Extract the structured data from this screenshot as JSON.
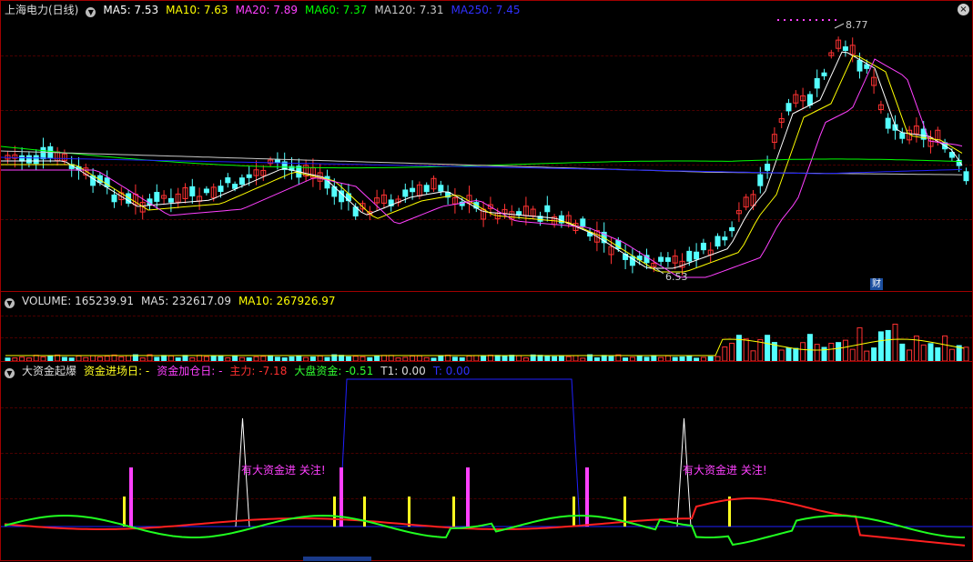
{
  "price_header": {
    "title": "上海电力(日线)",
    "ma5": "MA5: 7.53",
    "ma10": "MA10: 7.63",
    "ma20": "MA20: 7.89",
    "ma60": "MA60: 7.37",
    "ma120": "MA120: 7.31",
    "ma250": "MA250: 7.45"
  },
  "price_marks": {
    "high": "8.77",
    "low": "6.53",
    "finance_badge": "财"
  },
  "volume_header": {
    "label": "VOLUME: 165239.91",
    "ma5": "MA5: 232617.09",
    "ma10": "MA10: 267926.97"
  },
  "indicator_header": {
    "name": "大资金起爆",
    "entry_day": "资金进场日: -",
    "add_day": "资金加仓日: -",
    "main_force": "主力: -7.18",
    "market_fund": "大盘资金: -0.51",
    "t1": "T1: 0.00",
    "t": "T: 0.00"
  },
  "alerts": {
    "left": "有大资金进 关注!",
    "right": "有大资金进 关注!"
  },
  "colors": {
    "up": "#ff3232",
    "down": "#54ffff",
    "ma5": "#ffffff",
    "ma10": "#ffff00",
    "ma20": "#ff40ff",
    "ma60": "#00ff00",
    "ma120": "#c8c8c8",
    "ma250": "#2020ff",
    "main_force": "#ff2020",
    "market_fund": "#20ff20",
    "entry_bar": "#ffff20",
    "add_bar": "#ff40ff"
  },
  "icons": {
    "collapse": "chevron-down-icon",
    "close": "close-icon"
  }
}
